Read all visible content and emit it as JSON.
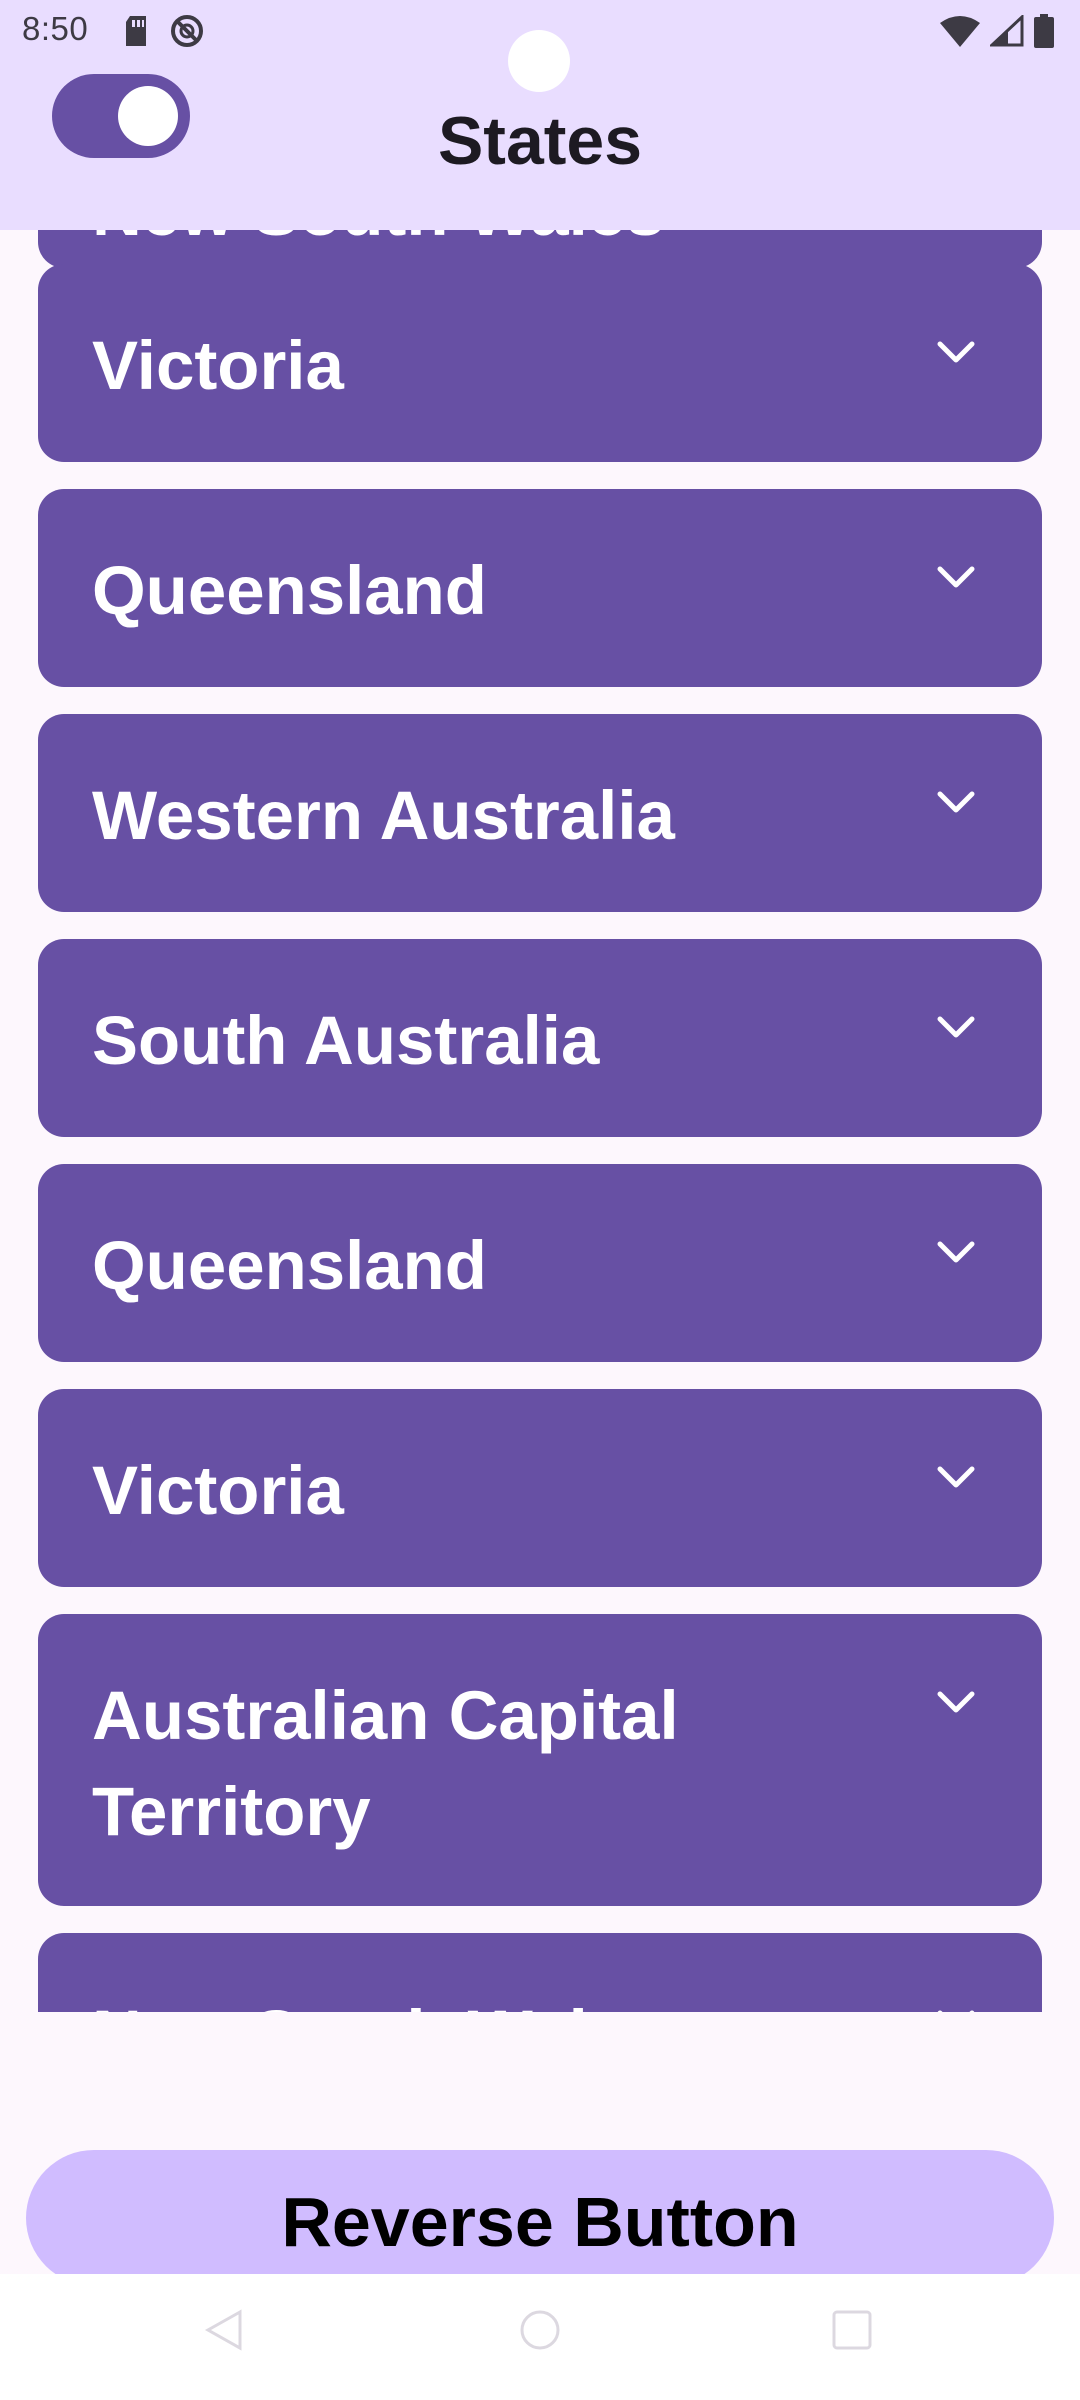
{
  "status_bar": {
    "time": "8:50",
    "icons": [
      "sd-card-icon",
      "no-disturb-icon",
      "wifi-icon",
      "signal-icon",
      "battery-icon"
    ]
  },
  "app_bar": {
    "title": "States",
    "toggle": {
      "state": "on",
      "icon": "toggle-switch"
    }
  },
  "list": {
    "items": [
      {
        "label": "New South Wales",
        "expanded": false
      },
      {
        "label": "Victoria",
        "expanded": false
      },
      {
        "label": "Queensland",
        "expanded": false
      },
      {
        "label": "Western Australia",
        "expanded": false
      },
      {
        "label": "South Australia",
        "expanded": false
      },
      {
        "label": "Queensland",
        "expanded": false
      },
      {
        "label": "Victoria",
        "expanded": false
      },
      {
        "label": "Australian Capital Territory",
        "expanded": false
      },
      {
        "label": "New South Wales",
        "expanded": false
      }
    ]
  },
  "reverse_button": {
    "label": "Reverse Button"
  },
  "nav_bar": {
    "buttons": [
      "back-icon",
      "home-icon",
      "recents-icon"
    ]
  },
  "colors": {
    "primary": "#6750a4",
    "app_bar_bg": "#e9ddff",
    "button_bg": "#d0bcff",
    "page_bg": "#fdf7fd"
  }
}
